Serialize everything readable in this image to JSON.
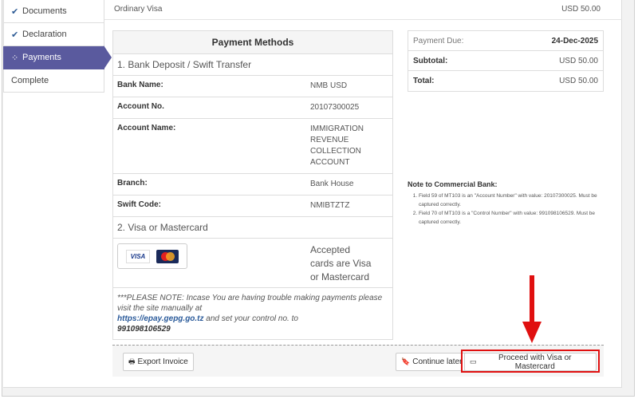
{
  "sidebar": {
    "items": [
      {
        "label": "Documents",
        "icon": "check-icon"
      },
      {
        "label": "Declaration",
        "icon": "check-icon"
      },
      {
        "label": "Payments",
        "icon": "spinner-icon"
      },
      {
        "label": "Complete",
        "icon": ""
      }
    ]
  },
  "top": {
    "item": "Ordinary Visa",
    "amount": "USD 50.00"
  },
  "payment_methods": {
    "title": "Payment Methods",
    "section1": "1. Bank Deposit / Swift Transfer",
    "rows": [
      {
        "key": "Bank Name:",
        "value": "NMB USD"
      },
      {
        "key": "Account No.",
        "value": "20107300025"
      },
      {
        "key": "Account Name:",
        "value": "IMMIGRATION REVENUE COLLECTION ACCOUNT"
      },
      {
        "key": "Branch:",
        "value": "Bank House"
      },
      {
        "key": "Swift Code:",
        "value": "NMIBTZTZ"
      }
    ],
    "section2": "2. Visa or Mastercard",
    "visa_label": "VISA",
    "accepted": "Accepted cards are Visa or Mastercard",
    "note": {
      "text1": "***PLEASE NOTE: Incase You are having trouble making payments please visit the site manually at",
      "link": "https://epay.gepg.go.tz",
      "text2": "and set your control no. to",
      "control": "991098106529"
    }
  },
  "summary": {
    "payment_due_label": "Payment Due:",
    "payment_due_value": "24-Dec-2025",
    "subtotal_label": "Subtotal:",
    "subtotal_value": "USD 50.00",
    "total_label": "Total:",
    "total_value": "USD 50.00"
  },
  "bank_note": {
    "title": "Note to Commercial Bank:",
    "items": [
      "Field 59 of MT103 is an \"Account Number\" with value: 20107300025. Must be captured correctly.",
      "Field 70 of MT103 is a \"Control Number\" with value: 991098106529. Must be captured correctly."
    ]
  },
  "footer": {
    "export_label": "Export Invoice",
    "continue_label": "Continue later",
    "proceed_label": "Proceed with Visa or Mastercard"
  },
  "colors": {
    "accent": "#5a5a9e",
    "highlight": "#e01010"
  }
}
